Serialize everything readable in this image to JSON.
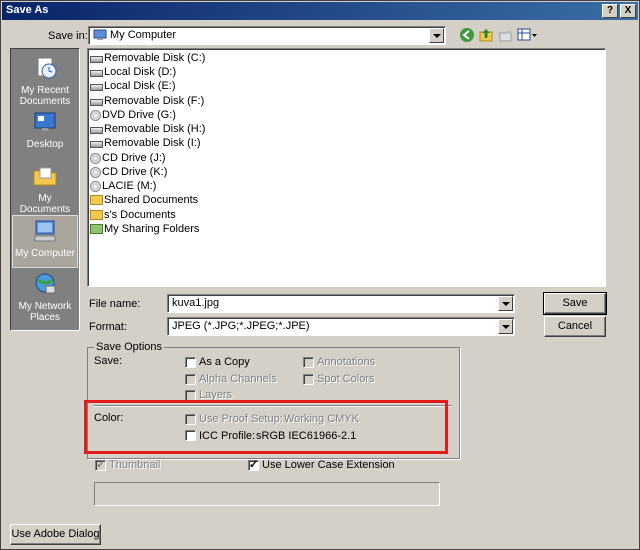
{
  "window": {
    "title": "Save As",
    "help_btn": "?",
    "close_btn": "X"
  },
  "save_in": {
    "label": "Save in:",
    "value": "My Computer"
  },
  "places": [
    {
      "label": "My Recent Documents",
      "icon": "recent-documents-icon"
    },
    {
      "label": "Desktop",
      "icon": "desktop-icon"
    },
    {
      "label": "My Documents",
      "icon": "my-documents-icon"
    },
    {
      "label": "My Computer",
      "icon": "my-computer-icon",
      "selected": true
    },
    {
      "label": "My Network Places",
      "icon": "network-places-icon"
    }
  ],
  "files": [
    {
      "name": "Removable Disk (C:)",
      "icon": "drive"
    },
    {
      "name": "Local Disk (D:)",
      "icon": "drive"
    },
    {
      "name": "Local Disk (E:)",
      "icon": "drive"
    },
    {
      "name": "Removable Disk (F:)",
      "icon": "drive"
    },
    {
      "name": "DVD Drive (G:)",
      "icon": "disc"
    },
    {
      "name": "Removable Disk (H:)",
      "icon": "drive"
    },
    {
      "name": "Removable Disk (I:)",
      "icon": "drive"
    },
    {
      "name": "CD Drive (J:)",
      "icon": "disc"
    },
    {
      "name": "CD Drive (K:)",
      "icon": "disc"
    },
    {
      "name": "LACIE (M:)",
      "icon": "disc"
    },
    {
      "name": "Shared Documents",
      "icon": "folder"
    },
    {
      "name": "s's Documents",
      "icon": "folder"
    },
    {
      "name": "My Sharing Folders",
      "icon": "share"
    }
  ],
  "file_name": {
    "label": "File name:",
    "value": "kuva1.jpg"
  },
  "format": {
    "label": "Format:",
    "value": "JPEG (*.JPG;*.JPEG;*.JPE)"
  },
  "buttons": {
    "save": "Save",
    "cancel": "Cancel",
    "adobe": "Use Adobe Dialog"
  },
  "save_options": {
    "title": "Save Options",
    "save_label": "Save:",
    "as_copy": {
      "label": "As a Copy",
      "checked": false,
      "enabled": true
    },
    "annotations": {
      "label": "Annotations",
      "checked": false,
      "enabled": false
    },
    "alpha_channels": {
      "label": "Alpha Channels",
      "checked": false,
      "enabled": false
    },
    "spot_colors": {
      "label": "Spot Colors",
      "checked": false,
      "enabled": false
    },
    "layers": {
      "label": "Layers",
      "checked": false,
      "enabled": false
    },
    "color_label": "Color:",
    "proof_setup": {
      "label": "Use Proof Setup:",
      "value": "Working CMYK",
      "checked": false,
      "enabled": false
    },
    "icc_profile": {
      "label": "ICC Profile:",
      "value": "sRGB IEC61966-2.1",
      "checked": false,
      "enabled": true
    }
  },
  "thumbnail": {
    "label": "Thumbnail",
    "checked": true,
    "enabled": false
  },
  "lowercase_ext": {
    "label": "Use Lower Case Extension",
    "checked": true,
    "enabled": true
  },
  "colors": {
    "titlebar": "#0a246a",
    "face": "#d4d0c8",
    "highlight_box": "#e31b1b"
  }
}
